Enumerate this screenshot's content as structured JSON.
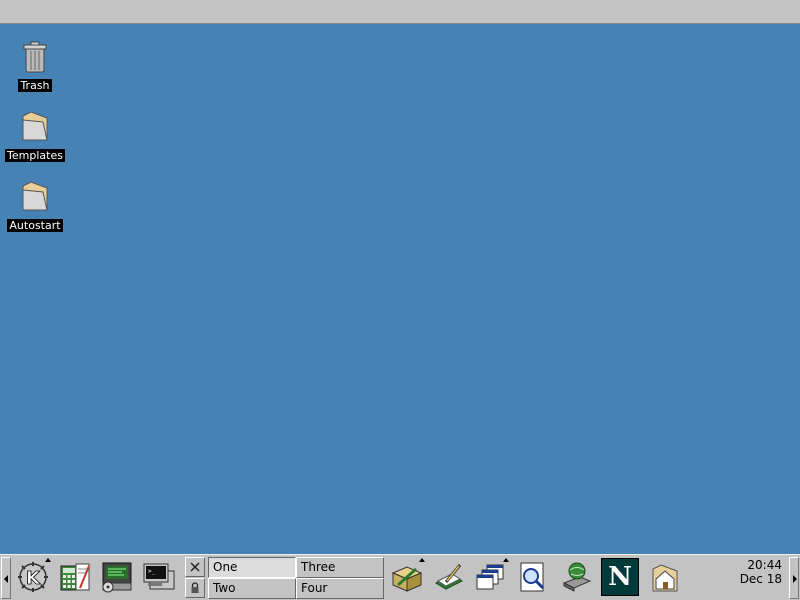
{
  "desktop": {
    "background": "#4682b4",
    "icons": [
      {
        "label": "Trash",
        "icon": "trash-icon"
      },
      {
        "label": "Templates",
        "icon": "folder-icon"
      },
      {
        "label": "Autostart",
        "icon": "folder-icon"
      }
    ]
  },
  "panel": {
    "launchers": [
      "k-menu-icon",
      "calculator-editor-icon",
      "control-center-icon",
      "terminal-icon",
      "package-manager-icon",
      "kedit-icon",
      "windows-list-icon",
      "kfind-icon",
      "network-drive-icon",
      "netscape-icon",
      "home-folder-icon"
    ],
    "netscape_letter": "N",
    "desktops": [
      "One",
      "Two",
      "Three",
      "Four"
    ],
    "active_desktop": "One",
    "clock": {
      "time": "20:44",
      "date": "Dec 18"
    }
  }
}
